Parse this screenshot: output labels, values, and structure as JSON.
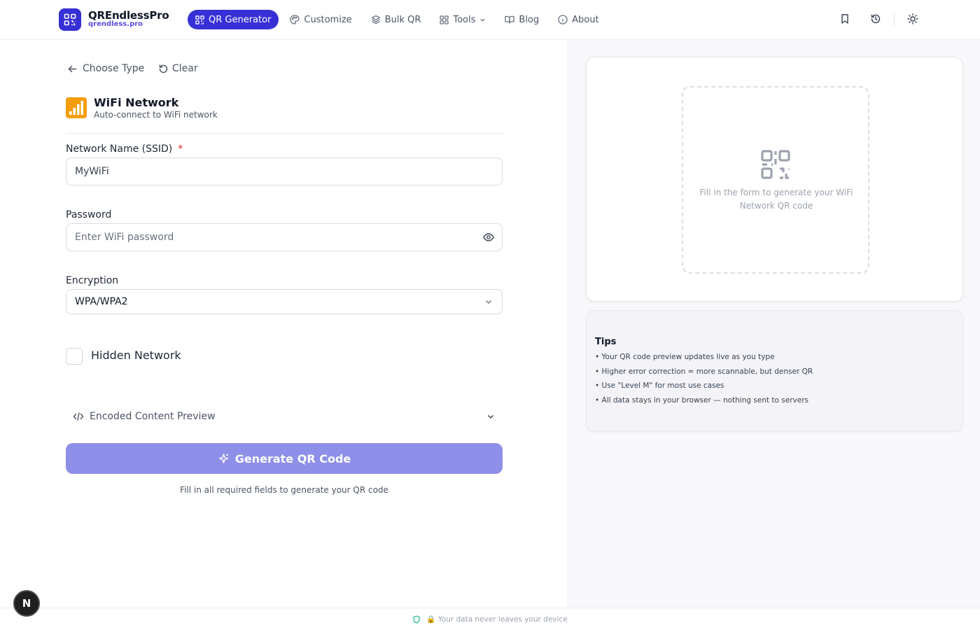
{
  "header": {
    "brand_name": "QREndlessPro",
    "brand_url": "qrendless.pro",
    "nav": [
      {
        "label": "QR Generator",
        "active": true
      },
      {
        "label": "Customize"
      },
      {
        "label": "Bulk QR"
      },
      {
        "label": "Tools"
      },
      {
        "label": "Blog"
      },
      {
        "label": "About"
      }
    ]
  },
  "form": {
    "back_label": "Choose Type",
    "clear_label": "Clear",
    "type_title": "WiFi Network",
    "type_desc": "Auto-connect to WiFi network",
    "ssid_label": "Network Name (SSID)",
    "required_mark": "*",
    "ssid_value": "MyWiFi",
    "password_label": "Password",
    "password_placeholder": "Enter WiFi password",
    "encryption_label": "Encryption",
    "encryption_value": "WPA/WPA2",
    "hidden_label": "Hidden Network",
    "preview_label": "Encoded Content Preview",
    "generate_label": "Generate QR Code",
    "hint": "Fill in all required fields to generate your QR code"
  },
  "preview": {
    "empty_text": "Fill in the form to generate your WiFi Network QR code"
  },
  "tips": {
    "title": "Tips",
    "items": [
      "• Your QR code preview updates live as you type",
      "• Higher error correction = more scannable, but denser QR",
      "• Use \"Level M\" for most use cases",
      "• All data stays in your browser — nothing sent to servers"
    ]
  },
  "footer": {
    "text": "🔒 Your data never leaves your device"
  },
  "fab": {
    "label": "N"
  },
  "colors": {
    "primary": "#3730d6",
    "button_disabled": "#8e8fe8",
    "required": "#dc2626"
  }
}
